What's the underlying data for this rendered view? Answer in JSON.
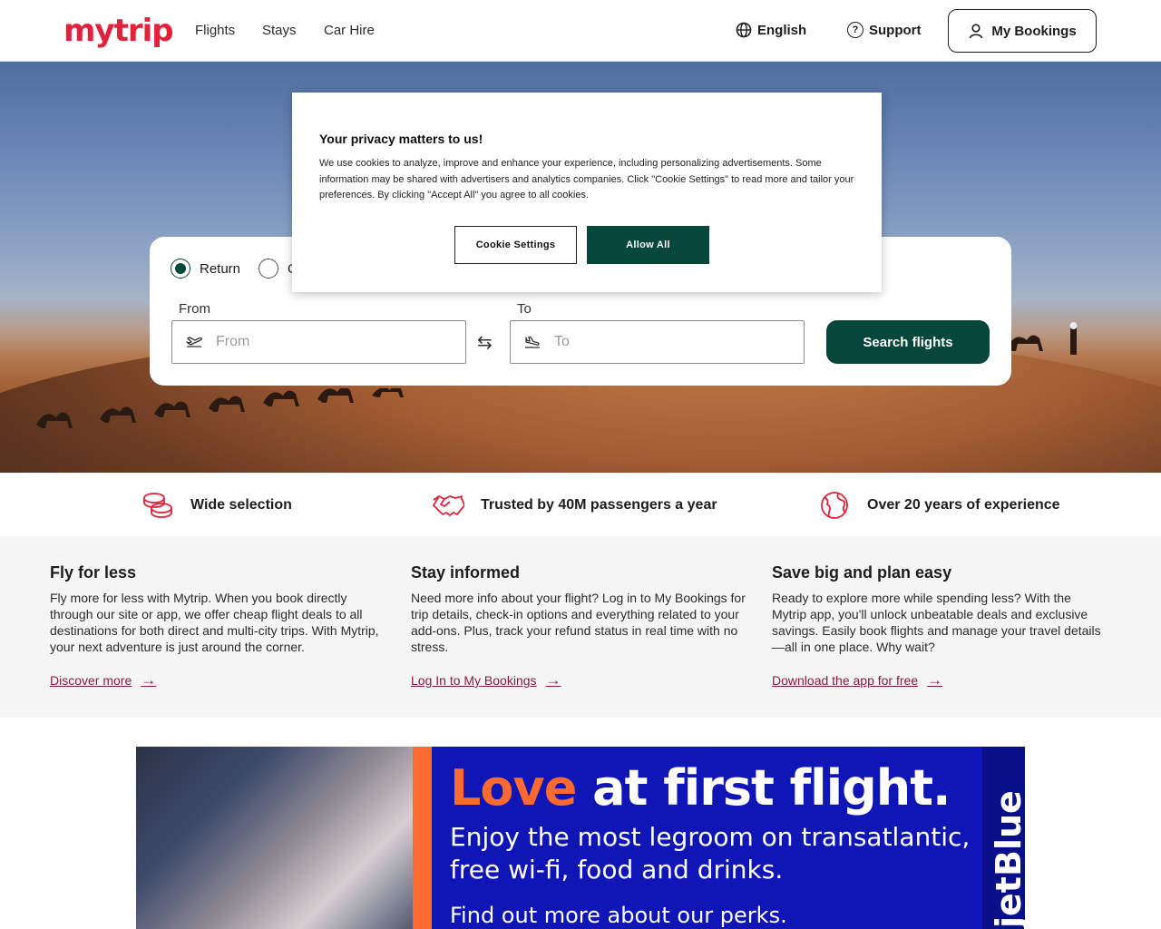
{
  "header": {
    "logo": "mytrip",
    "nav": [
      "Flights",
      "Stays",
      "Car Hire"
    ],
    "language": "English",
    "support": "Support",
    "bookings": "My Bookings"
  },
  "search": {
    "trip_types": [
      "Return",
      "On"
    ],
    "selected_trip_type": "Return",
    "from_label": "From",
    "from_placeholder": "From",
    "to_label": "To",
    "to_placeholder": "To",
    "button": "Search flights"
  },
  "cookie": {
    "title": "Your privacy matters to us!",
    "body": "We use cookies to analyze, improve and enhance your experience, including personalizing advertisements. Some information may be shared with advertisers and analytics companies. Click \"Cookie Settings\" to read more and tailor your preferences. By clicking \"Accept All\" you agree to all cookies.",
    "settings_button": "Cookie Settings",
    "allow_button": "Allow All"
  },
  "features": [
    {
      "label": "Wide selection",
      "icon": "coins-icon"
    },
    {
      "label": "Trusted by 40M passengers a year",
      "icon": "handshake-icon"
    },
    {
      "label": "Over 20 years of experience",
      "icon": "globe-icon"
    }
  ],
  "info": [
    {
      "title": "Fly for less",
      "body": "Fly more for less with Mytrip. When you book directly through our site or app, we offer cheap flight deals to all destinations for both direct and multi-city trips. With Mytrip, your next adventure is just around the corner.",
      "link": "Discover more"
    },
    {
      "title": "Stay informed",
      "body": "Need more info about your flight? Log in to My Bookings for trip details, check-in options and everything related to your add-ons. Plus, track your refund status in real time with no stress.",
      "link": "Log In to My Bookings"
    },
    {
      "title": "Save big and plan easy",
      "body": "Ready to explore more while spending less? With the Mytrip app, you'll unlock unbeatable deals and exclusive savings. Easily book flights and manage your travel details—all in one place. Why wait?",
      "link": "Download the app for free"
    }
  ],
  "ad": {
    "title_highlight": "Love",
    "title_rest": "at first flight.",
    "subtitle": "Enjoy the most legroom on transatlantic, free wi-fi, food and drinks.",
    "cta": "Find out more about our perks.",
    "brand": "jetBlue"
  },
  "colors": {
    "brand_red": "#e0223b",
    "primary_green": "#06473b",
    "link_maroon": "#8b1c3a",
    "ad_blue": "#1016b6",
    "ad_orange": "#ff6b2c"
  }
}
